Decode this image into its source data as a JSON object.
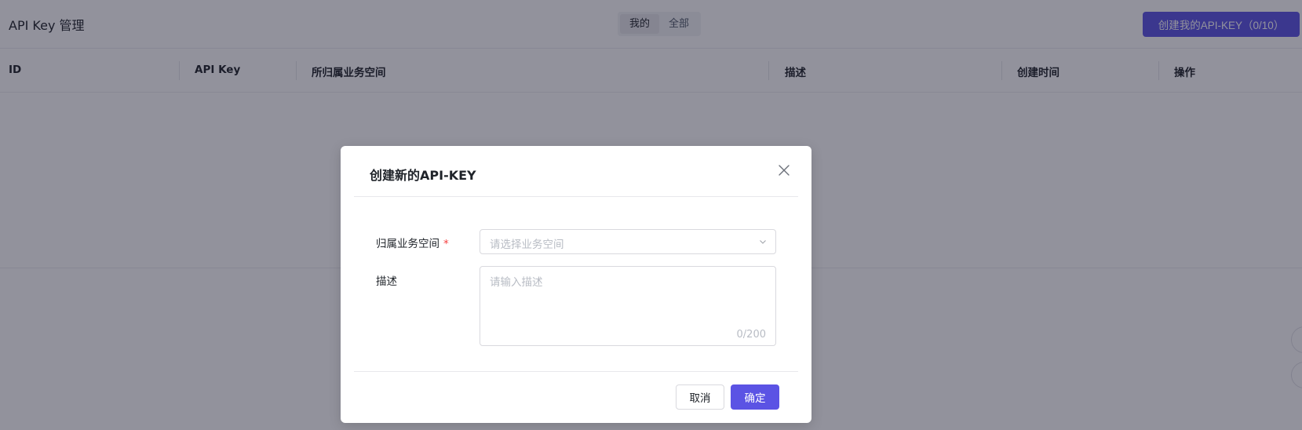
{
  "header": {
    "title": "API Key 管理",
    "tabs": [
      {
        "label": "我的"
      },
      {
        "label": "全部"
      }
    ],
    "create_button": "创建我的API-KEY（0/10）"
  },
  "table": {
    "columns": [
      "ID",
      "API Key",
      "所归属业务空间",
      "描述",
      "创建时间",
      "操作"
    ],
    "rows": []
  },
  "modal": {
    "title": "创建新的API-KEY",
    "fields": {
      "workspace": {
        "label": "归属业务空间",
        "required_mark": "*",
        "placeholder": "请选择业务空间",
        "value": ""
      },
      "description": {
        "label": "描述",
        "placeholder": "请输入描述",
        "value": "",
        "counter": "0/200"
      }
    },
    "cancel_label": "取消",
    "ok_label": "确定"
  },
  "colors": {
    "accent": "#5b53e4",
    "required": "#f53f3f",
    "mask": "rgba(23,23,45,0.47)"
  },
  "icons": {
    "close": "close-icon",
    "select_arrow": "chevron-down-icon"
  }
}
